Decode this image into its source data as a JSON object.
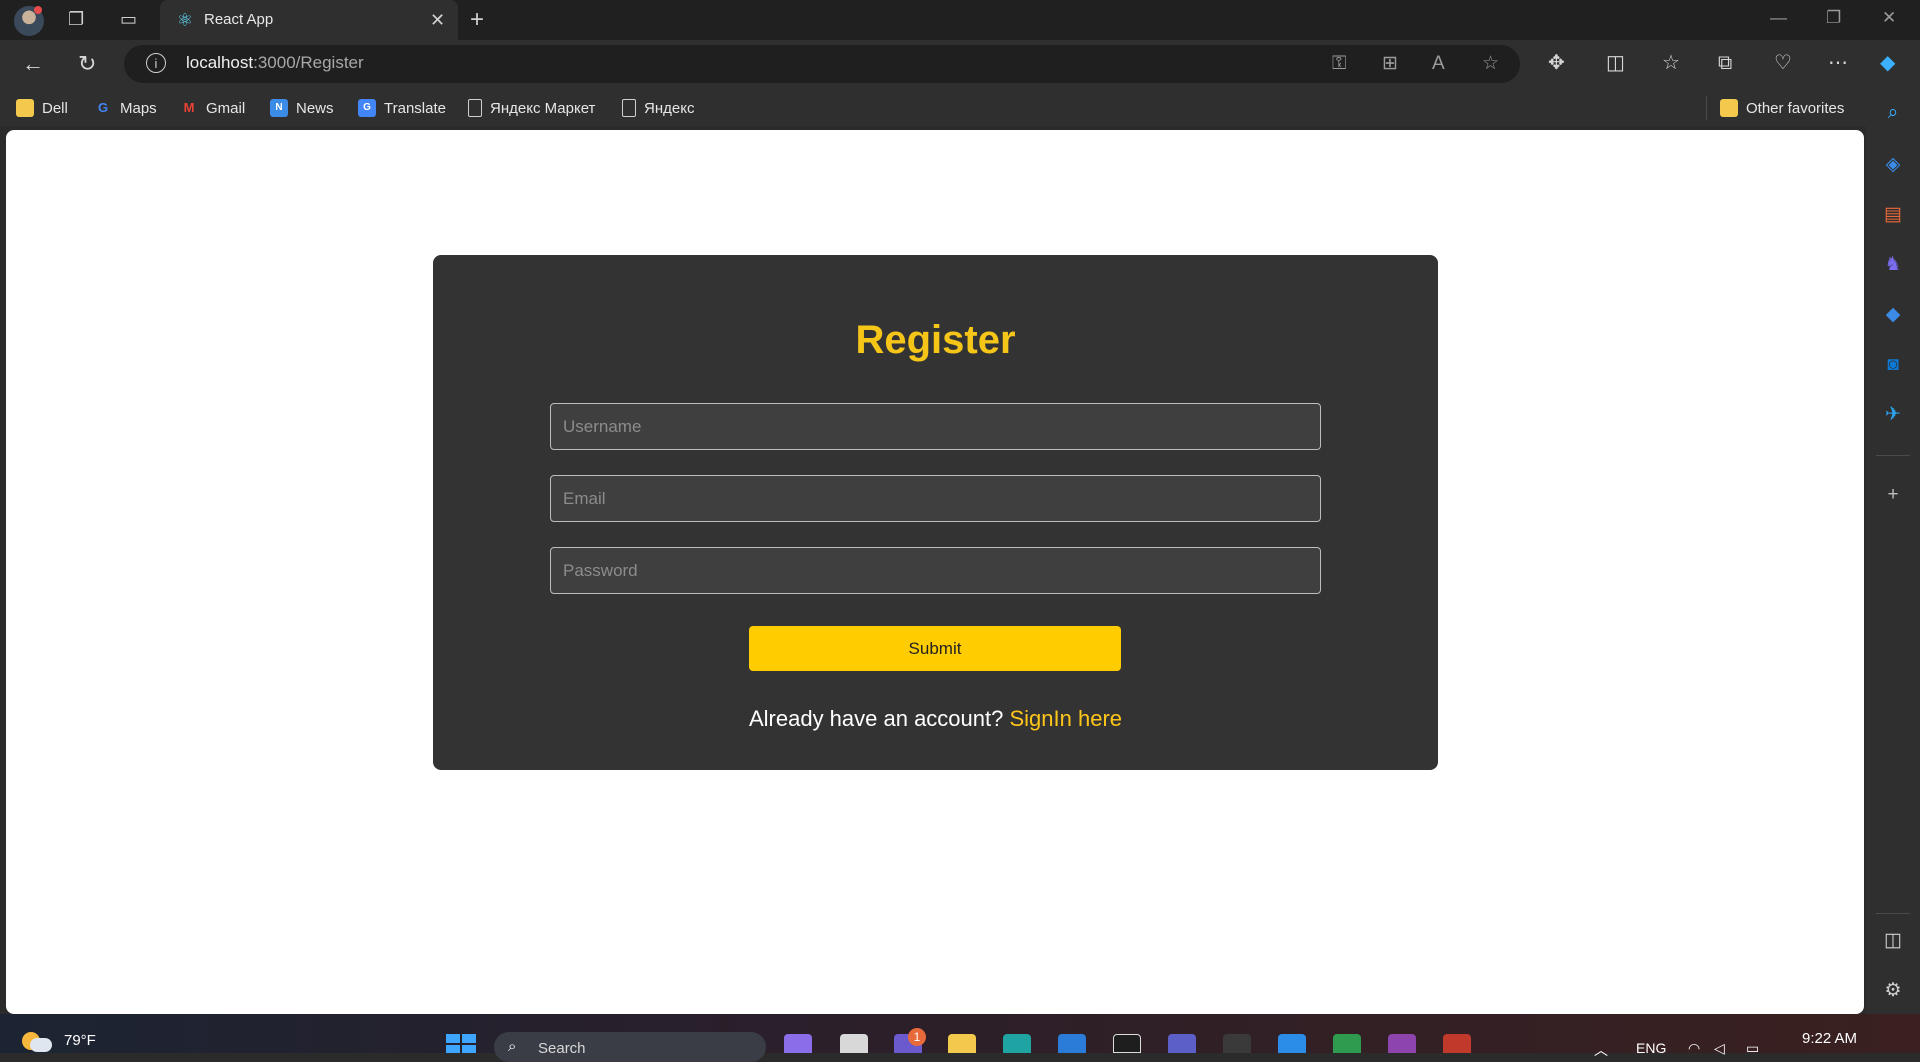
{
  "browser": {
    "tab_title": "React App",
    "url_host": "localhost",
    "url_rest": ":3000/Register",
    "tab_icon": "react-atom-icon"
  },
  "favorites": [
    {
      "label": "Dell",
      "icon": "folder-icon",
      "color": "#f2c94c"
    },
    {
      "label": "Maps",
      "icon": "google-icon",
      "color": "#4285f4"
    },
    {
      "label": "Gmail",
      "icon": "gmail-icon",
      "color": "#ea4335"
    },
    {
      "label": "News",
      "icon": "news-icon",
      "color": "#3c8ce7"
    },
    {
      "label": "Translate",
      "icon": "translate-icon",
      "color": "#4285f4"
    },
    {
      "label": "Яндекс Маркет",
      "icon": "page-icon",
      "color": "#cfcfcf"
    },
    {
      "label": "Яндекс",
      "icon": "page-icon",
      "color": "#cfcfcf"
    }
  ],
  "other_favorites": "Other favorites",
  "form": {
    "title": "Register",
    "username_placeholder": "Username",
    "email_placeholder": "Email",
    "password_placeholder": "Password",
    "submit_label": "Submit",
    "signin_prompt": "Already have an account?",
    "signin_link": "SignIn here"
  },
  "colors": {
    "accent": "#f5c518",
    "button": "#ffcc00",
    "card": "#333333"
  },
  "taskbar": {
    "temperature": "79°F",
    "search_label": "Search",
    "notification_count": "1",
    "language": "ENG",
    "time": "9:22 AM"
  }
}
